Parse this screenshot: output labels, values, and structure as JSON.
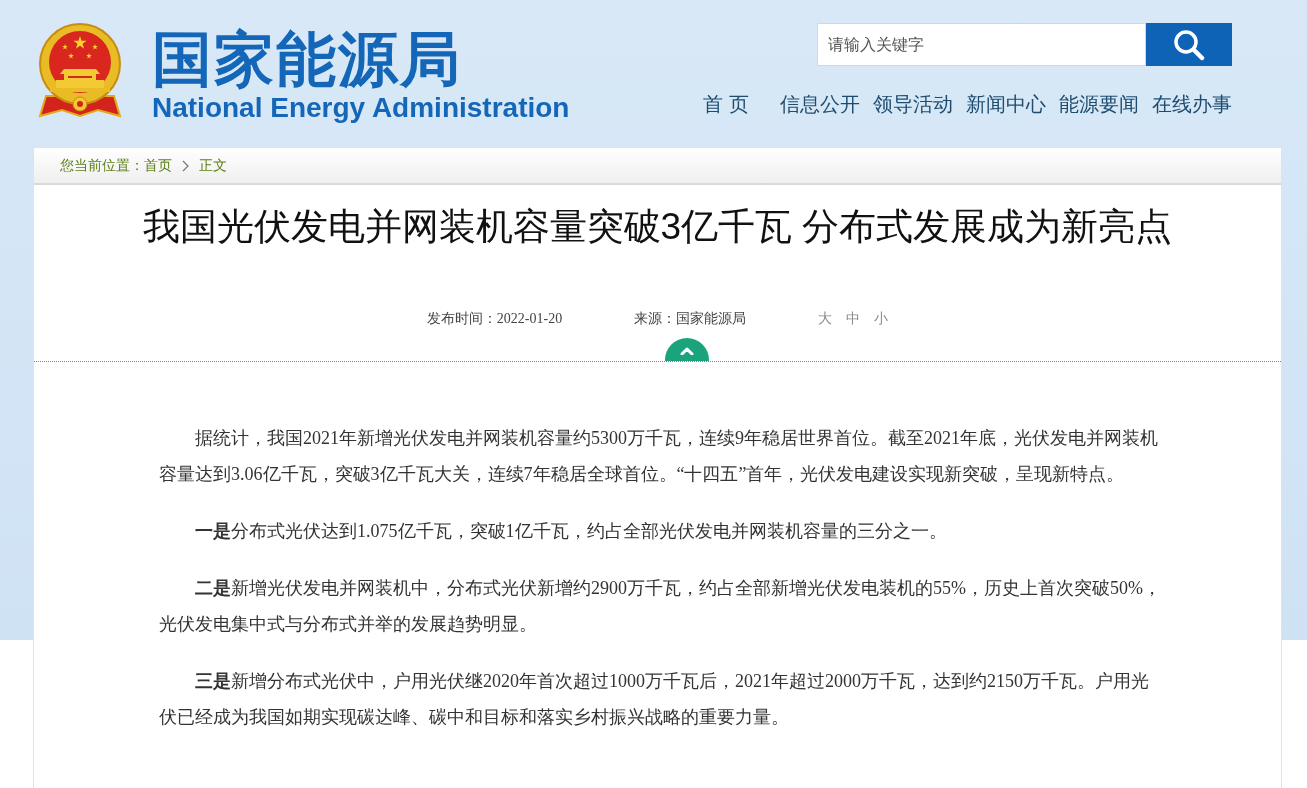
{
  "header": {
    "site_title": "国家能源局",
    "site_subtitle": "National Energy Administration",
    "search": {
      "placeholder": "请输入关键字"
    },
    "nav": [
      "首 页",
      "信息公开",
      "领导活动",
      "新闻中心",
      "能源要闻",
      "在线办事"
    ]
  },
  "breadcrumb": {
    "label": "您当前位置：",
    "items": [
      "首页",
      "正文"
    ]
  },
  "article": {
    "title": "我国光伏发电并网装机容量突破3亿千瓦 分布式发展成为新亮点",
    "published": "发布时间：2022-01-20",
    "source": "来源：国家能源局",
    "font_sizes": [
      "大",
      "中",
      "小"
    ],
    "paragraphs": [
      "据统计，我国2021年新增光伏发电并网装机容量约5300万千瓦，连续9年稳居世界首位。截至2021年底，光伏发电并网装机容量达到3.06亿千瓦，突破3亿千瓦大关，连续7年稳居全球首位。“十四五”首年，光伏发电建设实现新突破，呈现新特点。",
      "**一是**分布式光伏达到1.075亿千瓦，突破1亿千瓦，约占全部光伏发电并网装机容量的三分之一。",
      "**二是**新增光伏发电并网装机中，分布式光伏新增约2900万千瓦，约占全部新增光伏发电装机的55%，历史上首次突破50%，光伏发电集中式与分布式并举的发展趋势明显。",
      "**三是**新增分布式光伏中，户用光伏继2020年首次超过1000万千瓦后，2021年超过2000万千瓦，达到约2150万千瓦。户用光伏已经成为我国如期实现碳达峰、碳中和目标和落实乡村振兴战略的重要力量。"
    ]
  }
}
